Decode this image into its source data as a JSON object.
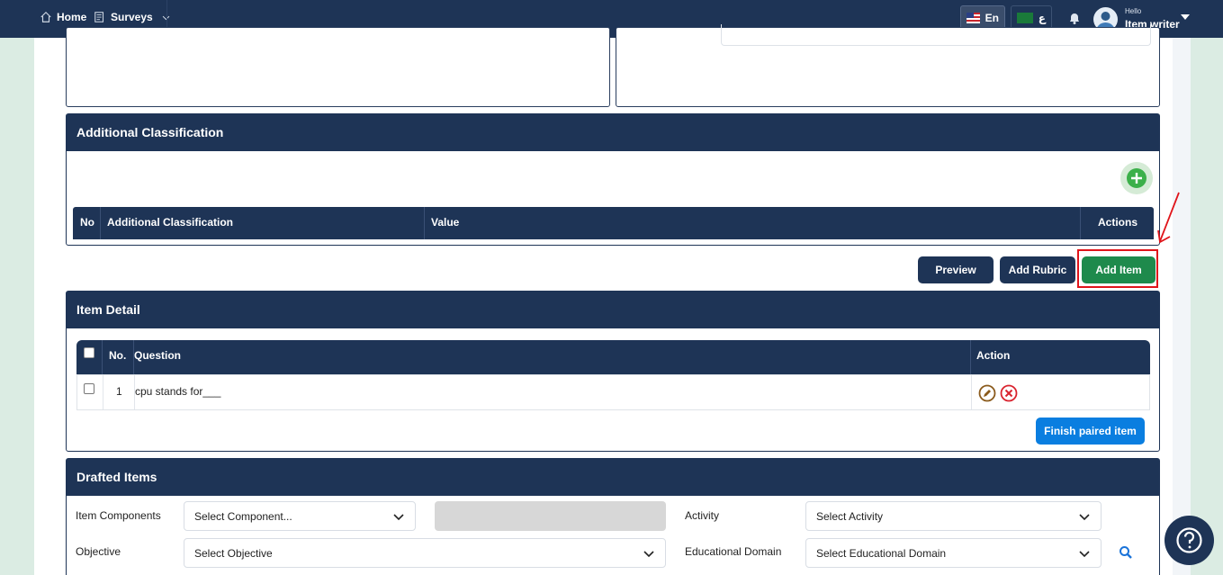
{
  "nav": {
    "home": "Home",
    "surveys": "Surveys",
    "lang_en": "En",
    "lang_ar": "ع",
    "hello": "Hello",
    "user": "Item writer"
  },
  "additional_classification": {
    "title": "Additional Classification",
    "columns": [
      "No",
      "Additional Classification",
      "Value",
      "Actions"
    ]
  },
  "actions": {
    "preview": "Preview",
    "add_rubric": "Add Rubric",
    "add_item": "Add Item"
  },
  "item_detail": {
    "title": "Item Detail",
    "columns": [
      "No.",
      "Question",
      "Action"
    ],
    "rows": [
      {
        "no": "1",
        "question": "cpu stands for___"
      }
    ],
    "finish_label": "Finish paired item"
  },
  "drafted_items": {
    "title": "Drafted Items",
    "item_components_label": "Item Components",
    "item_components_value": "Select Component...",
    "activity_label": "Activity",
    "activity_value": "Select Activity",
    "objective_label": "Objective",
    "objective_value": "Select Objective",
    "domain_label": "Educational Domain",
    "domain_value": "Select Educational Domain"
  },
  "colors": {
    "navy": "#1e3456",
    "green": "#1e8a4c",
    "blue": "#0a7ee0",
    "highlight": "#e0141a"
  }
}
